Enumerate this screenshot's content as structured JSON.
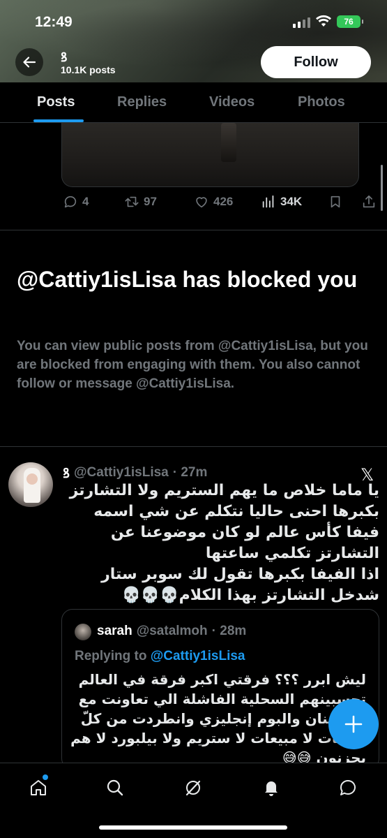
{
  "status_bar": {
    "time": "12:49",
    "battery": "76",
    "battery_color": "#34c759"
  },
  "header": {
    "profile_logo": "ꝸ",
    "post_count": "10.1K posts",
    "follow_label": "Follow"
  },
  "tabs": [
    {
      "label": "Posts",
      "active": true
    },
    {
      "label": "Replies",
      "active": false
    },
    {
      "label": "Videos",
      "active": false
    },
    {
      "label": "Photos",
      "active": false
    }
  ],
  "previous_post": {
    "replies": "4",
    "reposts": "97",
    "likes": "426",
    "views": "34K"
  },
  "blocked": {
    "title": "@Cattiy1isLisa has blocked you",
    "description": "You can view public posts from @Cattiy1isLisa, but you are blocked from engaging with them. You also cannot follow or message @Cattiy1isLisa."
  },
  "tweet": {
    "logo": "ꝸ",
    "handle": "@Cattiy1isLisa",
    "time": "· 27m",
    "text": "يا ماما خلاص ما يهم الستريم ولا التشارتز بكبرها احنى حاليا نتكلم عن شي اسمه فيفا كأس عالم لو كان موضوعنا عن التشارتز تكلمي ساعتها\nاذا الفيفا بكبرها تقول لك سوبر ستار شدخل التشارتز بهذا الكلام💀💀💀"
  },
  "quote": {
    "name": "sarah",
    "handle": "@satalmoh",
    "time": "· 28m",
    "replying_prefix": "Replying to",
    "replying_handle": "@Cattiy1isLisa",
    "text": "ليش ابرر ؟؟؟ فرقتي اكبر فرقة في العالم تحسبينهم السحلية الفاشلة الي تعاونت مع ...ة فنان والبوم إنجليزي وانطردت من كلّ ...طات لا مبيعات لا ستريم ولا بيلبورد لا هم يحزنون 😅😅"
  },
  "colors": {
    "accent": "#1d9bf0",
    "background": "#000000",
    "muted_text": "#71767b",
    "divider": "#2f3336"
  },
  "icons": {
    "back": "arrow-left-icon",
    "compose": "plus-icon",
    "nav": [
      "home-icon",
      "search-icon",
      "grok-icon",
      "notifications-icon",
      "messages-icon"
    ]
  }
}
